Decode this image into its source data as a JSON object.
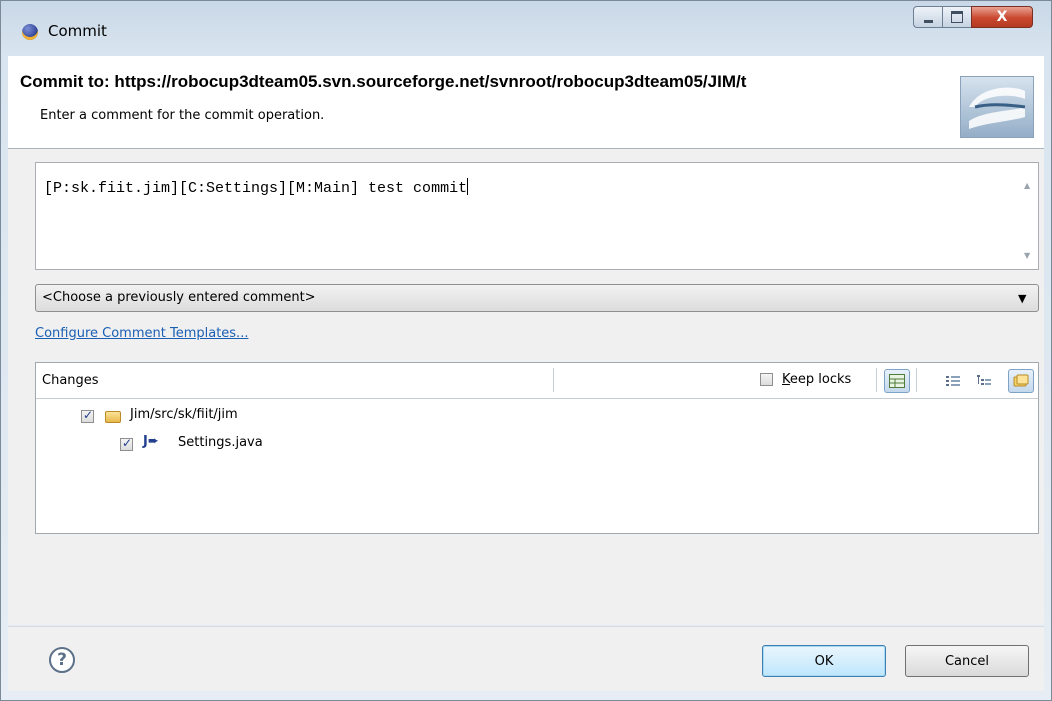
{
  "window": {
    "title": "Commit",
    "close_label": "X"
  },
  "header": {
    "title": "Commit to: https://robocup3dteam05.svn.sourceforge.net/svnroot/robocup3dteam05/JIM/t",
    "description": "Enter a comment for the commit operation."
  },
  "comment": {
    "value": "[P:sk.fiit.jim][C:Settings][M:Main] test commit"
  },
  "previous_comments": {
    "selected": "<Choose a previously entered comment>"
  },
  "configure_link": "Configure Comment Templates...",
  "changes": {
    "label": "Changes",
    "keep_locks": {
      "prefix": "K",
      "rest": "eep locks",
      "checked": false
    },
    "tree": [
      {
        "label": "Jim/src/sk/fiit/jim",
        "icon": "folder-icon",
        "checked": true
      },
      {
        "label": "Settings.java",
        "icon": "java-file-icon",
        "checked": true
      }
    ]
  },
  "buttons": {
    "help": "?",
    "ok": "OK",
    "cancel": "Cancel"
  },
  "colors": {
    "link": "#1a5fb4",
    "close_button": "#c9482f",
    "ok_button": "#bee6fd"
  }
}
